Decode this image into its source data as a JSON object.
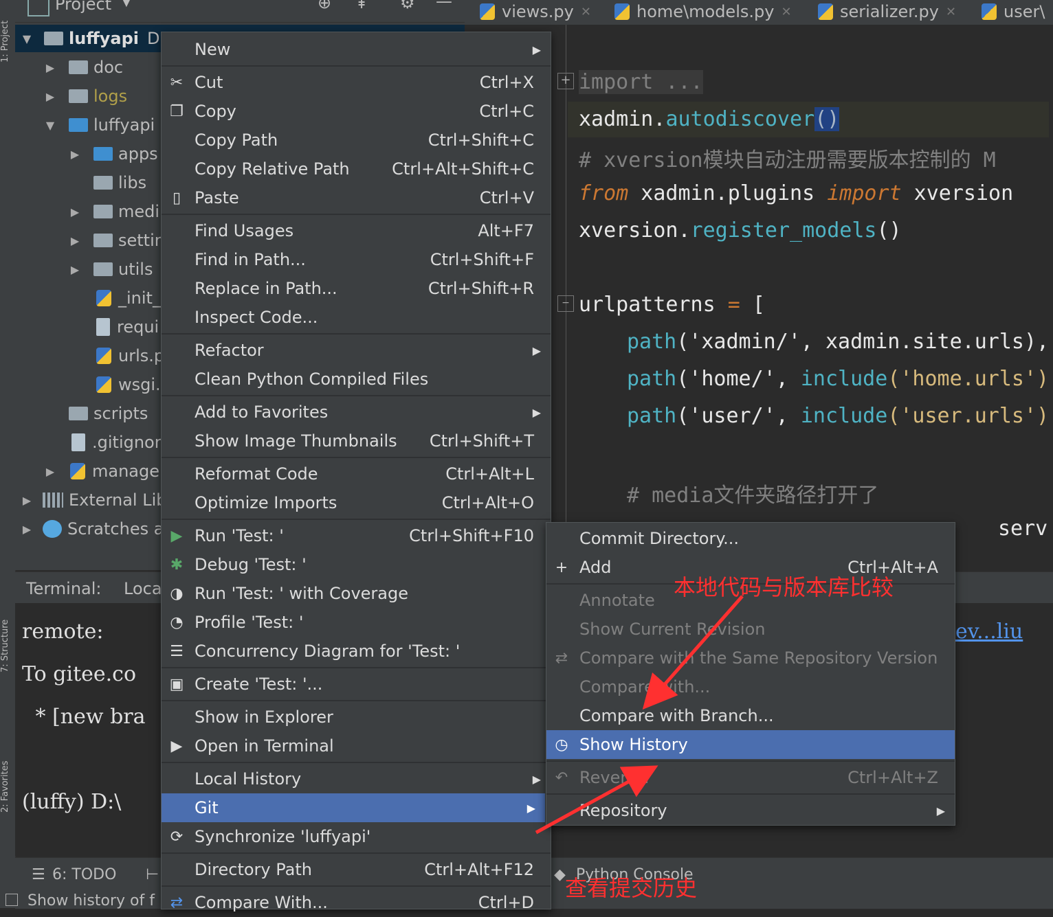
{
  "left_stripe": {
    "project_tab": "1: Project",
    "structure_tab": "7: Structure",
    "favorites_tab": "2: Favorites"
  },
  "project_panel": {
    "header_title": "Project",
    "tree": [
      {
        "label": "luffyapi",
        "suffix": "D:",
        "depth": 0,
        "expanded": true,
        "icon": "folder-icon",
        "bold": true
      },
      {
        "label": "doc",
        "depth": 1,
        "icon": "folder-icon"
      },
      {
        "label": "logs",
        "depth": 1,
        "icon": "folder-icon",
        "color": "#b1a04a"
      },
      {
        "label": "luffyapi",
        "depth": 1,
        "expanded": true,
        "icon": "folder-icon-blue"
      },
      {
        "label": "apps",
        "depth": 2,
        "icon": "folder-icon-blue"
      },
      {
        "label": "libs",
        "depth": 2,
        "icon": "folder-icon"
      },
      {
        "label": "medi",
        "depth": 2,
        "icon": "folder-icon"
      },
      {
        "label": "settin",
        "depth": 2,
        "icon": "folder-icon"
      },
      {
        "label": "utils",
        "depth": 2,
        "icon": "folder-icon"
      },
      {
        "label": "_init_",
        "depth": 2,
        "icon": "python-file-icon"
      },
      {
        "label": "requi",
        "depth": 2,
        "icon": "text-file-icon"
      },
      {
        "label": "urls.p",
        "depth": 2,
        "icon": "python-file-icon"
      },
      {
        "label": "wsgi.",
        "depth": 2,
        "icon": "python-file-icon"
      },
      {
        "label": "scripts",
        "depth": 1,
        "icon": "folder-icon"
      },
      {
        "label": ".gitignor",
        "depth": 1,
        "icon": "text-file-icon"
      },
      {
        "label": "manage",
        "depth": 1,
        "icon": "python-file-icon"
      },
      {
        "label": "External Lib",
        "depth": 0,
        "icon": "library-icon"
      },
      {
        "label": "Scratches a",
        "depth": 0,
        "icon": "scratches-icon"
      }
    ]
  },
  "editor": {
    "tabs": [
      "views.py",
      "home\\models.py",
      "serializer.py",
      "user\\"
    ],
    "lines": {
      "l1": "import ...",
      "l2a": "xadmin.",
      "l2b": "autodiscover",
      "l2c": "()",
      "l3": "# xversion模块自动注册需要版本控制的 M",
      "l4a": "from",
      "l4b": " xadmin.plugins ",
      "l4c": "import",
      "l4d": " xversion",
      "l5a": "xversion.",
      "l5b": "register_models",
      "l5c": "()",
      "l6a": "urlpatterns",
      "l6b": " = ",
      "l6c": "[",
      "l7a": "path",
      "l7b": "('",
      "l7c": "xadmin/",
      "l7d": "', xadmin.site.urls),",
      "l8a": "path",
      "l8b": "('",
      "l8c": "home/",
      "l8d": "', ",
      "l8e": "include",
      "l8f": "('home.urls')",
      "l9a": "path",
      "l9b": "('",
      "l9c": "user/",
      "l9d": "', ",
      "l9e": "include",
      "l9f": "('user.urls')",
      "l10": "# media文件夹路径打开了",
      "l11": "serv"
    }
  },
  "terminal": {
    "tab_label": "Terminal:",
    "tab_local": "Loca",
    "lines": [
      "remote:",
      "To gitee.co",
      " * [new bra",
      "(luffy) D:\\"
    ],
    "link_text": "ev...liu"
  },
  "bottom_bar": {
    "todo": "6: TODO",
    "status": "Show history of f",
    "python_console": "Python Console"
  },
  "context_menu": {
    "items": [
      {
        "label": "New",
        "shortcut": "",
        "submenu": true,
        "icon": ""
      },
      {
        "label": "Cut",
        "shortcut": "Ctrl+X",
        "icon": "scissors-icon",
        "glyph": "✂"
      },
      {
        "label": "Copy",
        "shortcut": "Ctrl+C",
        "icon": "copy-icon",
        "glyph": "❐"
      },
      {
        "label": "Copy Path",
        "shortcut": "Ctrl+Shift+C"
      },
      {
        "label": "Copy Relative Path",
        "shortcut": "Ctrl+Alt+Shift+C"
      },
      {
        "label": "Paste",
        "shortcut": "Ctrl+V",
        "icon": "clipboard-icon",
        "glyph": "▯"
      },
      {
        "label": "Find Usages",
        "shortcut": "Alt+F7"
      },
      {
        "label": "Find in Path...",
        "shortcut": "Ctrl+Shift+F"
      },
      {
        "label": "Replace in Path...",
        "shortcut": "Ctrl+Shift+R"
      },
      {
        "label": "Inspect Code...",
        "shortcut": ""
      },
      {
        "label": "Refactor",
        "shortcut": "",
        "submenu": true
      },
      {
        "label": "Clean Python Compiled Files",
        "shortcut": ""
      },
      {
        "label": "Add to Favorites",
        "shortcut": "",
        "submenu": true
      },
      {
        "label": "Show Image Thumbnails",
        "shortcut": "Ctrl+Shift+T"
      },
      {
        "label": "Reformat Code",
        "shortcut": "Ctrl+Alt+L"
      },
      {
        "label": "Optimize Imports",
        "shortcut": "Ctrl+Alt+O"
      },
      {
        "label": "Run 'Test: '",
        "shortcut": "Ctrl+Shift+F10",
        "icon": "run-icon",
        "glyph": "▶"
      },
      {
        "label": "Debug 'Test: '",
        "shortcut": "",
        "icon": "debug-icon",
        "glyph": "✱"
      },
      {
        "label": "Run 'Test: ' with Coverage",
        "shortcut": "",
        "icon": "coverage-icon",
        "glyph": "◑"
      },
      {
        "label": "Profile 'Test: '",
        "shortcut": "",
        "icon": "profile-icon",
        "glyph": "◔"
      },
      {
        "label": "Concurrency Diagram for 'Test: '",
        "shortcut": "",
        "icon": "concurrency-icon",
        "glyph": "☰"
      },
      {
        "label": "Create 'Test: '...",
        "shortcut": "",
        "icon": "create-test-icon",
        "glyph": "▣"
      },
      {
        "label": "Show in Explorer",
        "shortcut": ""
      },
      {
        "label": "Open in Terminal",
        "shortcut": "",
        "icon": "terminal-icon",
        "glyph": "▶"
      },
      {
        "label": "Local History",
        "shortcut": "",
        "submenu": true
      },
      {
        "label": "Git",
        "shortcut": "",
        "submenu": true
      },
      {
        "label": "Synchronize 'luffyapi'",
        "shortcut": "",
        "icon": "sync-icon",
        "glyph": "⟳"
      },
      {
        "label": "Directory Path",
        "shortcut": "Ctrl+Alt+F12"
      },
      {
        "label": "Compare With...",
        "shortcut": "Ctrl+D",
        "icon": "compare-icon",
        "glyph": "⇄"
      }
    ]
  },
  "git_submenu": {
    "items": [
      {
        "label": "Commit Directory...",
        "shortcut": ""
      },
      {
        "label": "Add",
        "shortcut": "Ctrl+Alt+A",
        "icon": "plus-icon",
        "glyph": "+"
      },
      {
        "label": "Annotate",
        "shortcut": ""
      },
      {
        "label": "Show Current Revision",
        "shortcut": ""
      },
      {
        "label": "Compare with the Same Repository Version",
        "shortcut": "",
        "icon": "compare-icon",
        "glyph": "⇄"
      },
      {
        "label": "Compare with...",
        "shortcut": ""
      },
      {
        "label": "Compare with Branch...",
        "shortcut": ""
      },
      {
        "label": "Show History",
        "shortcut": "",
        "icon": "clock-icon",
        "glyph": "◷"
      },
      {
        "label": "Revert...",
        "shortcut": "Ctrl+Alt+Z",
        "icon": "revert-icon",
        "glyph": "↶"
      },
      {
        "label": "Repository",
        "shortcut": "",
        "submenu": true
      }
    ]
  },
  "annotations": {
    "compare_note": "本地代码与版本库比较",
    "history_note": "查看提交历史"
  },
  "colors": {
    "highlight": "#4b6eaf",
    "annotation_red": "#ff3030"
  }
}
